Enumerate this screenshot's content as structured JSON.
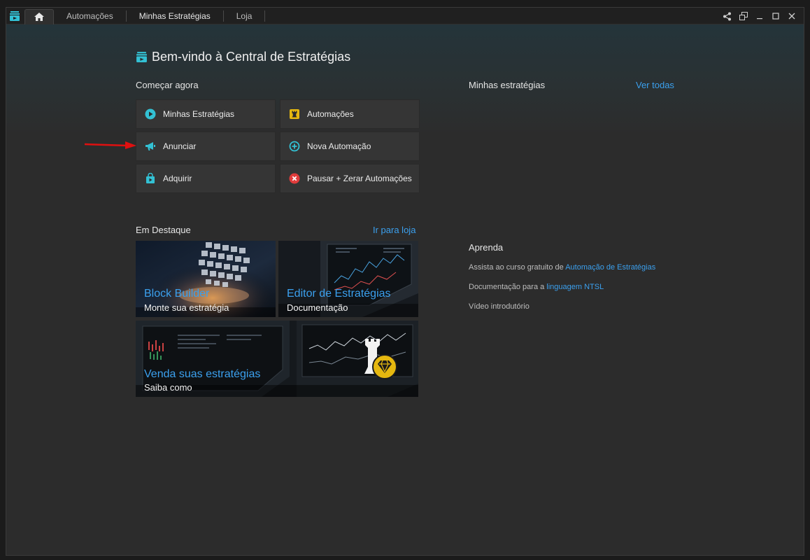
{
  "tabs": [
    {
      "label": "Automações"
    },
    {
      "label": "Minhas Estratégias"
    },
    {
      "label": "Loja"
    }
  ],
  "header": {
    "title": "Bem-vindo à Central de Estratégias"
  },
  "start": {
    "label": "Começar agora",
    "buttons": [
      {
        "label": "Minhas Estratégias",
        "icon": "play-icon"
      },
      {
        "label": "Automações",
        "icon": "rook-icon"
      },
      {
        "label": "Anunciar",
        "icon": "megaphone-icon"
      },
      {
        "label": "Nova Automação",
        "icon": "plus-circle-icon"
      },
      {
        "label": "Adquirir",
        "icon": "shopping-bag-icon"
      },
      {
        "label": "Pausar + Zerar Automações",
        "icon": "close-circle-icon"
      }
    ]
  },
  "my_strategies": {
    "label": "Minhas estratégias",
    "link": "Ver todas"
  },
  "featured": {
    "label": "Em Destaque",
    "link": "Ir para loja",
    "cards": [
      {
        "title": "Block Builder",
        "subtitle": "Monte sua estratégia"
      },
      {
        "title": "Editor de Estratégias",
        "subtitle": "Documentação"
      },
      {
        "title": "Venda suas estratégias",
        "subtitle": "Saiba como"
      }
    ]
  },
  "learn": {
    "label": "Aprenda",
    "line1_prefix": "Assista ao curso gratuito de ",
    "line1_link": "Automação de Estratégias",
    "line2_prefix": "Documentação para a ",
    "line2_link": "linguagem NTSL",
    "line3": "Vídeo introdutório"
  },
  "colors": {
    "accent": "#3ba0ee",
    "teal": "#33c1d4",
    "gold": "#e6b80f",
    "danger": "#e03b3b"
  }
}
